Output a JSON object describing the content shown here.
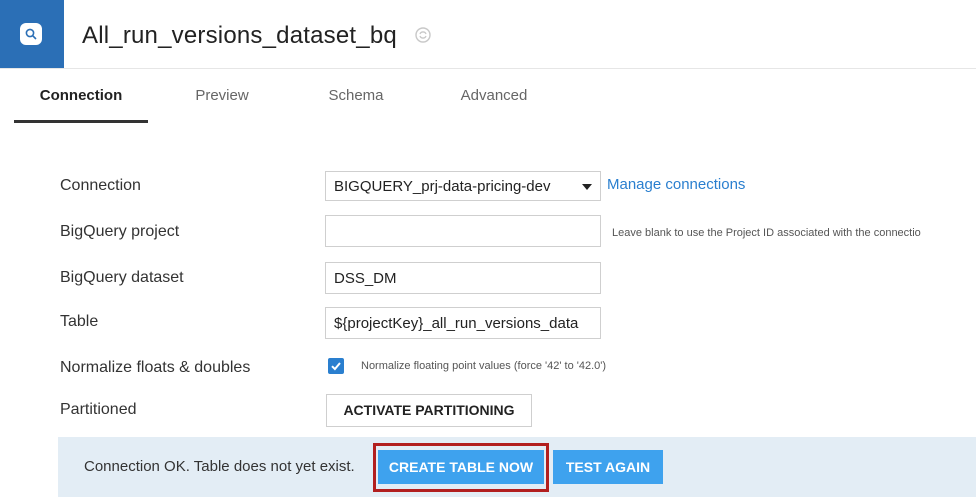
{
  "header": {
    "title": "All_run_versions_dataset_bq",
    "logo_icon": "dataset-icon",
    "badge_icon": "sync-badge-icon",
    "brand_color": "#2b6fb6"
  },
  "tabs": [
    {
      "label": "Connection",
      "active": true
    },
    {
      "label": "Preview",
      "active": false
    },
    {
      "label": "Schema",
      "active": false
    },
    {
      "label": "Advanced",
      "active": false
    }
  ],
  "form": {
    "connection": {
      "label": "Connection",
      "selected": "BIGQUERY_prj-data-pricing-dev",
      "manage_link": "Manage connections"
    },
    "project": {
      "label": "BigQuery project",
      "value": "",
      "hint": "Leave blank to use the Project ID associated with the connectio"
    },
    "dataset": {
      "label": "BigQuery dataset",
      "value": "DSS_DM"
    },
    "table": {
      "label": "Table",
      "value": "${projectKey}_all_run_versions_data"
    },
    "normalize": {
      "label": "Normalize floats & doubles",
      "checked": true,
      "hint": "Normalize floating point values (force '42' to '42.0')"
    },
    "partitioned": {
      "label": "Partitioned",
      "button": "ACTIVATE PARTITIONING"
    }
  },
  "status": {
    "text": "Connection OK. Table does not yet exist.",
    "create_button": "CREATE TABLE NOW",
    "test_button": "TEST AGAIN",
    "bar_color": "#e3edf5",
    "button_color": "#3ea2ee",
    "highlight_color": "#b21f1f"
  }
}
